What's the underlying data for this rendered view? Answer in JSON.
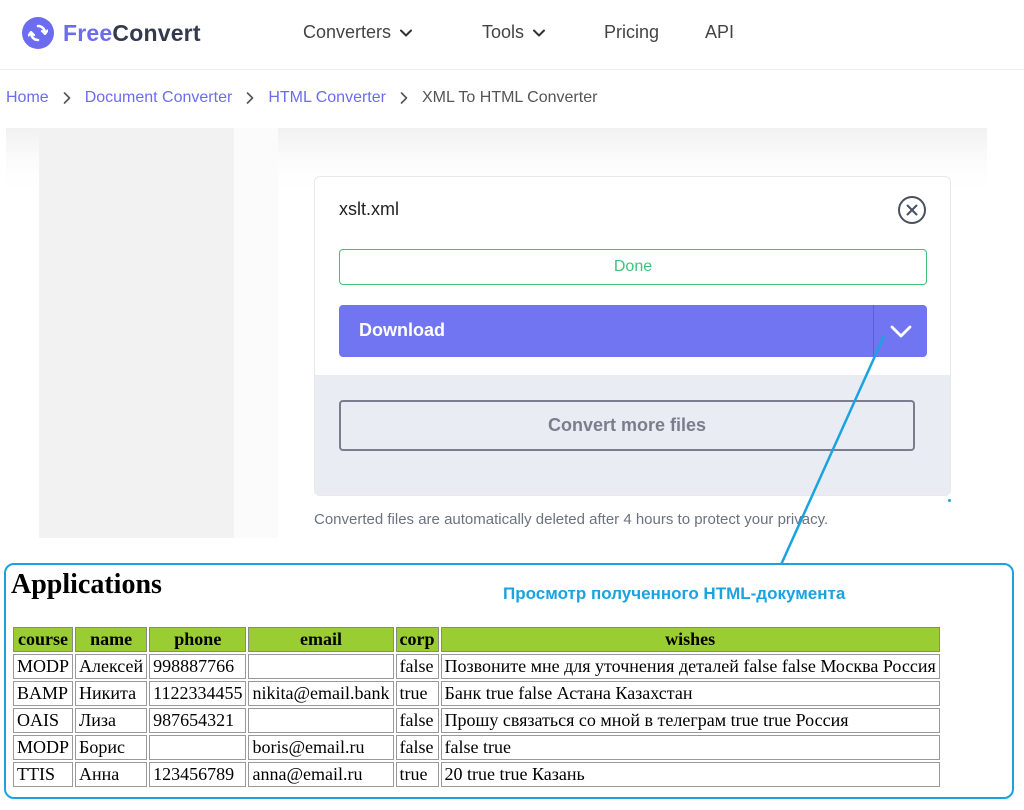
{
  "header": {
    "logo": {
      "free": "Free",
      "convert": "Convert"
    },
    "nav": [
      {
        "label": "Converters",
        "has_dropdown": true
      },
      {
        "label": "Tools",
        "has_dropdown": true
      },
      {
        "label": "Pricing",
        "has_dropdown": false
      },
      {
        "label": "API",
        "has_dropdown": false
      }
    ],
    "brand_color": "#6c6cf0"
  },
  "breadcrumb": {
    "items": [
      "Home",
      "Document Converter",
      "HTML Converter"
    ],
    "current": "XML To HTML Converter"
  },
  "file_card": {
    "file_name": "xslt.xml",
    "status": "Done",
    "status_color": "#3ec47a",
    "download_label": "Download",
    "download_color": "#7275f2",
    "convert_more_label": "Convert more files"
  },
  "privacy_note": "Converted files are automatically deleted after 4 hours to protect your privacy.",
  "callout": {
    "caption": "Просмотр полученного HTML-документа",
    "color": "#1aa3e0"
  },
  "preview": {
    "heading": "Applications",
    "header_color": "#9acd32",
    "columns": [
      "course",
      "name",
      "phone",
      "email",
      "corp",
      "wishes"
    ],
    "rows": [
      [
        "MODP",
        "Алексей",
        "998887766",
        "",
        "false",
        "Позвоните мне для уточнения деталей false false Москва Россия"
      ],
      [
        "BAMP",
        "Никита",
        "1122334455",
        "nikita@email.bank",
        "true",
        "Банк true false Астана Казахстан"
      ],
      [
        "OAIS",
        "Лиза",
        "987654321",
        "",
        "false",
        "Прошу связаться со мной в телеграм true true Россия"
      ],
      [
        "MODP",
        "Борис",
        "",
        "boris@email.ru",
        "false",
        "false true"
      ],
      [
        "TTIS",
        "Анна",
        "123456789",
        "anna@email.ru",
        "true",
        "20 true true Казань"
      ]
    ]
  }
}
